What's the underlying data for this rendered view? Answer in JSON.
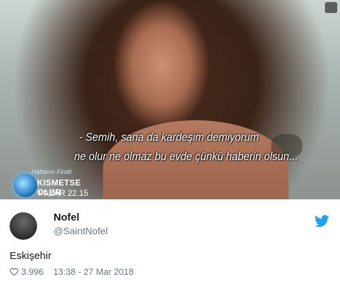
{
  "media": {
    "subtitle_line1": "- Semih, sana da kardeşim demiyorum",
    "subtitle_line2": "ne olur ne olmaz bu evde çünkü haberin olsun...",
    "show_small": "Haftanın Finali",
    "show_name": "KISMETSE OLUR",
    "show_time": "PAZAR 22.15"
  },
  "tweet": {
    "display_name": "Nofel",
    "handle": "@SaintNofel",
    "text": "Eskişehir",
    "likes": "3.996",
    "timestamp": "13:38 - 27 Mar 2018"
  },
  "colors": {
    "brand": "#1da1f2",
    "muted": "#657786"
  }
}
